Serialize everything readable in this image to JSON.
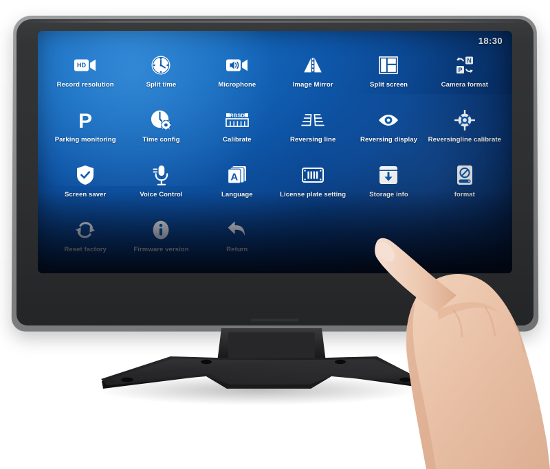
{
  "device": {
    "type": "car-dvr-touchscreen-monitor",
    "status_bar": {
      "time": "18:30"
    }
  },
  "screen": {
    "background_top_color": "#1d74c8",
    "background_bottom_color": "#020d22",
    "icon_color": "#ffffff",
    "label_color": "#ffffff"
  },
  "menu": {
    "columns": 6,
    "rows": 4,
    "items": [
      {
        "id": "record-resolution",
        "label": "Record resolution",
        "icon": "hd-camcorder-icon"
      },
      {
        "id": "split-time",
        "label": "Split time",
        "icon": "clock-icon"
      },
      {
        "id": "microphone",
        "label": "Microphone",
        "icon": "speaker-camcorder-icon"
      },
      {
        "id": "image-mirror",
        "label": "Image Mirror",
        "icon": "mirror-triangles-icon"
      },
      {
        "id": "split-screen",
        "label": "Split screen",
        "icon": "split-screen-layout-icon"
      },
      {
        "id": "camera-format",
        "label": "Camera format",
        "icon": "ntsc-pal-switch-icon"
      },
      {
        "id": "parking-monitoring",
        "label": "Parking monitoring",
        "icon": "letter-p-icon"
      },
      {
        "id": "time-config",
        "label": "Time config",
        "icon": "clock-gear-icon"
      },
      {
        "id": "calibrate",
        "label": "Calibrate",
        "icon": "rbsd-ruler-icon"
      },
      {
        "id": "reversing-line",
        "label": "Reversing line",
        "icon": "parking-guide-lines-icon"
      },
      {
        "id": "reversing-display",
        "label": "Reversing display",
        "icon": "eye-icon"
      },
      {
        "id": "reversingline-calibrate",
        "label": "Reversingline calibrate",
        "icon": "crosshair-target-icon"
      },
      {
        "id": "screen-saver",
        "label": "Screen saver",
        "icon": "shield-check-icon"
      },
      {
        "id": "voice-control",
        "label": "Voice Control",
        "icon": "microphone-icon"
      },
      {
        "id": "language",
        "label": "Language",
        "icon": "letter-a-cards-icon"
      },
      {
        "id": "license-plate-setting",
        "label": "License plate setting",
        "icon": "license-plate-icon"
      },
      {
        "id": "storage-info",
        "label": "Storage info",
        "icon": "storage-download-icon"
      },
      {
        "id": "format",
        "label": "format",
        "icon": "disk-prohibited-icon"
      },
      {
        "id": "reset-factory",
        "label": "Reset factory",
        "icon": "refresh-cycle-icon"
      },
      {
        "id": "firmware-version",
        "label": "Firmware version",
        "icon": "info-circle-icon"
      },
      {
        "id": "return",
        "label": "Return",
        "icon": "back-arrow-icon"
      }
    ],
    "icon_labels": {
      "hd_badge_text": "HD",
      "camera_format_primary": "N",
      "camera_format_secondary": "P",
      "parking_letter": "P",
      "calibrate_text": "RBSD",
      "language_letter": "A",
      "firmware_letter": "i"
    }
  },
  "hardware": {
    "bezel_color": "#2f3032",
    "shell_color": "#8e9092",
    "stand_color": "#1d1d1f",
    "stand_shape": "x-base-with-rectangular-neck"
  },
  "overlay": {
    "hand": "right-hand-index-finger-pointing-at-screen",
    "skin_color": "#e7bfa4"
  }
}
